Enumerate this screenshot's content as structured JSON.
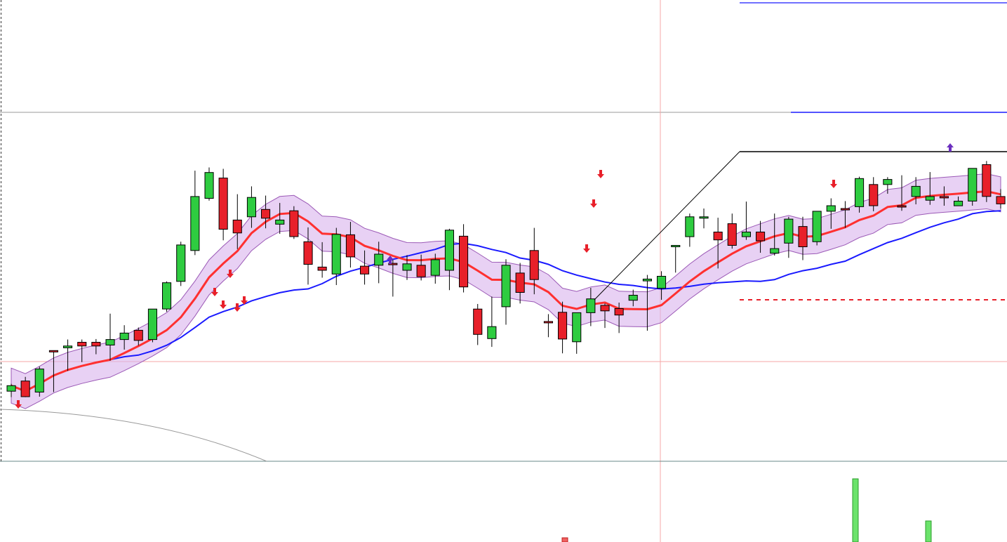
{
  "chart_data": {
    "type": "candlestick",
    "title": "",
    "xlabel": "",
    "ylabel": "",
    "grid": false,
    "legend": "none",
    "ylim": [
      0,
      1000
    ],
    "candles": [
      {
        "o": 152,
        "h": 168,
        "l": 139,
        "c": 164,
        "bull": true
      },
      {
        "o": 174,
        "h": 183,
        "l": 139,
        "c": 140,
        "bull": false
      },
      {
        "o": 150,
        "h": 205,
        "l": 140,
        "c": 200,
        "bull": true
      },
      {
        "o": 240,
        "h": 240,
        "l": 150,
        "c": 240,
        "bull": false
      },
      {
        "o": 250,
        "h": 264,
        "l": 196,
        "c": 246,
        "bull": true
      },
      {
        "o": 258,
        "h": 264,
        "l": 215,
        "c": 250,
        "bull": false
      },
      {
        "o": 250,
        "h": 265,
        "l": 232,
        "c": 258,
        "bull": false
      },
      {
        "o": 252,
        "h": 320,
        "l": 218,
        "c": 264,
        "bull": true
      },
      {
        "o": 264,
        "h": 295,
        "l": 242,
        "c": 278,
        "bull": true
      },
      {
        "o": 284,
        "h": 290,
        "l": 251,
        "c": 262,
        "bull": false
      },
      {
        "o": 264,
        "h": 315,
        "l": 258,
        "c": 330,
        "bull": true
      },
      {
        "o": 330,
        "h": 390,
        "l": 324,
        "c": 387,
        "bull": true
      },
      {
        "o": 390,
        "h": 476,
        "l": 380,
        "c": 469,
        "bull": true
      },
      {
        "o": 457,
        "h": 630,
        "l": 447,
        "c": 574,
        "bull": true
      },
      {
        "o": 570,
        "h": 637,
        "l": 565,
        "c": 626,
        "bull": true
      },
      {
        "o": 614,
        "h": 634,
        "l": 479,
        "c": 503,
        "bull": false
      },
      {
        "o": 523,
        "h": 579,
        "l": 460,
        "c": 495,
        "bull": false
      },
      {
        "o": 530,
        "h": 596,
        "l": 506,
        "c": 572,
        "bull": true
      },
      {
        "o": 546,
        "h": 576,
        "l": 505,
        "c": 527,
        "bull": false
      },
      {
        "o": 514,
        "h": 560,
        "l": 493,
        "c": 523,
        "bull": true
      },
      {
        "o": 543,
        "h": 553,
        "l": 482,
        "c": 487,
        "bull": false
      },
      {
        "o": 476,
        "h": 507,
        "l": 383,
        "c": 427,
        "bull": false
      },
      {
        "o": 421,
        "h": 475,
        "l": 398,
        "c": 414,
        "bull": false
      },
      {
        "o": 406,
        "h": 506,
        "l": 382,
        "c": 492,
        "bull": true
      },
      {
        "o": 491,
        "h": 519,
        "l": 420,
        "c": 443,
        "bull": false
      },
      {
        "o": 406,
        "h": 457,
        "l": 383,
        "c": 423,
        "bull": false
      },
      {
        "o": 425,
        "h": 476,
        "l": 386,
        "c": 449,
        "bull": true
      },
      {
        "o": 429,
        "h": 437,
        "l": 357,
        "c": 427,
        "bull": false
      },
      {
        "o": 428,
        "h": 447,
        "l": 393,
        "c": 414,
        "bull": true
      },
      {
        "o": 400,
        "h": 448,
        "l": 392,
        "c": 425,
        "bull": false
      },
      {
        "o": 403,
        "h": 450,
        "l": 385,
        "c": 437,
        "bull": true
      },
      {
        "o": 414,
        "h": 504,
        "l": 371,
        "c": 501,
        "bull": true
      },
      {
        "o": 488,
        "h": 514,
        "l": 366,
        "c": 378,
        "bull": false
      },
      {
        "o": 330,
        "h": 341,
        "l": 252,
        "c": 275,
        "bull": false
      },
      {
        "o": 266,
        "h": 357,
        "l": 248,
        "c": 292,
        "bull": true
      },
      {
        "o": 335,
        "h": 438,
        "l": 296,
        "c": 425,
        "bull": true
      },
      {
        "o": 408,
        "h": 430,
        "l": 342,
        "c": 366,
        "bull": false
      },
      {
        "o": 457,
        "h": 506,
        "l": 362,
        "c": 394,
        "bull": false
      },
      {
        "o": 302,
        "h": 319,
        "l": 269,
        "c": 303,
        "bull": false
      },
      {
        "o": 323,
        "h": 346,
        "l": 234,
        "c": 265,
        "bull": false
      },
      {
        "o": 259,
        "h": 314,
        "l": 233,
        "c": 322,
        "bull": true
      },
      {
        "o": 322,
        "h": 376,
        "l": 293,
        "c": 352,
        "bull": true
      },
      {
        "o": 338,
        "h": 342,
        "l": 289,
        "c": 326,
        "bull": false
      },
      {
        "o": 331,
        "h": 344,
        "l": 278,
        "c": 317,
        "bull": false
      },
      {
        "o": 349,
        "h": 372,
        "l": 336,
        "c": 360,
        "bull": true
      },
      {
        "o": 395,
        "h": 404,
        "l": 283,
        "c": 391,
        "bull": true
      },
      {
        "o": 401,
        "h": 412,
        "l": 350,
        "c": 375,
        "bull": true
      },
      {
        "o": 468,
        "h": 467,
        "l": 409,
        "c": 467,
        "bull": true
      },
      {
        "o": 487,
        "h": 537,
        "l": 465,
        "c": 530,
        "bull": true
      },
      {
        "o": 530,
        "h": 548,
        "l": 505,
        "c": 530,
        "bull": true
      },
      {
        "o": 497,
        "h": 528,
        "l": 418,
        "c": 480,
        "bull": false
      },
      {
        "o": 515,
        "h": 537,
        "l": 461,
        "c": 468,
        "bull": false
      },
      {
        "o": 497,
        "h": 563,
        "l": 480,
        "c": 487,
        "bull": true
      },
      {
        "o": 497,
        "h": 521,
        "l": 452,
        "c": 478,
        "bull": false
      },
      {
        "o": 451,
        "h": 537,
        "l": 446,
        "c": 461,
        "bull": true
      },
      {
        "o": 473,
        "h": 530,
        "l": 441,
        "c": 525,
        "bull": true
      },
      {
        "o": 509,
        "h": 530,
        "l": 436,
        "c": 465,
        "bull": false
      },
      {
        "o": 476,
        "h": 542,
        "l": 468,
        "c": 542,
        "bull": true
      },
      {
        "o": 542,
        "h": 570,
        "l": 504,
        "c": 554,
        "bull": true
      },
      {
        "o": 548,
        "h": 564,
        "l": 506,
        "c": 546,
        "bull": false
      },
      {
        "o": 552,
        "h": 617,
        "l": 539,
        "c": 613,
        "bull": true
      },
      {
        "o": 600,
        "h": 616,
        "l": 542,
        "c": 554,
        "bull": false
      },
      {
        "o": 600,
        "h": 616,
        "l": 580,
        "c": 611,
        "bull": true
      },
      {
        "o": 554,
        "h": 620,
        "l": 543,
        "c": 554,
        "bull": false
      },
      {
        "o": 574,
        "h": 616,
        "l": 557,
        "c": 596,
        "bull": true
      },
      {
        "o": 566,
        "h": 627,
        "l": 556,
        "c": 574,
        "bull": true
      },
      {
        "o": 574,
        "h": 596,
        "l": 554,
        "c": 574,
        "bull": false
      },
      {
        "o": 554,
        "h": 574,
        "l": 554,
        "c": 564,
        "bull": true
      },
      {
        "o": 564,
        "h": 635,
        "l": 554,
        "c": 635,
        "bull": true
      },
      {
        "o": 643,
        "h": 651,
        "l": 562,
        "c": 574,
        "bull": false
      },
      {
        "o": 574,
        "h": 590,
        "l": 548,
        "c": 558,
        "bull": false
      }
    ],
    "ma_red": [],
    "ma_blue": [],
    "volume": [
      {
        "value": 90,
        "bull": true
      },
      {
        "value": 30,
        "bull": true
      },
      {
        "value": 6,
        "bull": false
      }
    ]
  }
}
